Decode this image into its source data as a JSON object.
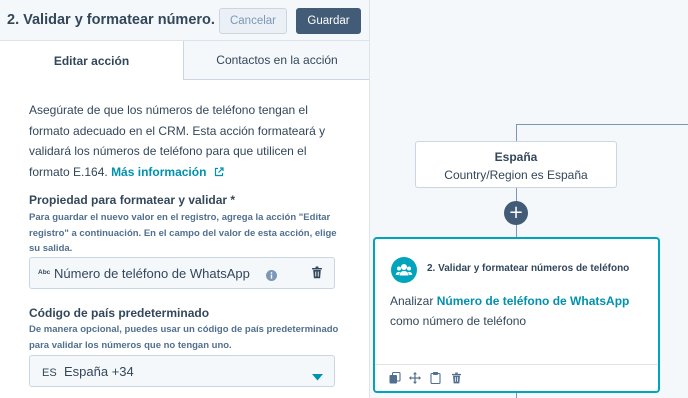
{
  "panel": {
    "title": "2. Validar y formatear número...",
    "cancel_label": "Cancelar",
    "save_label": "Guardar",
    "tabs": [
      {
        "label": "Editar acción",
        "active": true
      },
      {
        "label": "Contactos en la acción",
        "active": false
      }
    ],
    "description": "Asegúrate de que los números de teléfono tengan el formato adecuado en el CRM. Esta acción formateará y validará los números de teléfono para que utilicen el formato E.164.",
    "more_info_link": "Más información",
    "property": {
      "label": "Propiedad para formatear y validar *",
      "help": "Para guardar el nuevo valor en el registro, agrega la acción \"Editar registro\" a continuación. En el campo del valor de esta acción, elige su salida.",
      "type_badge": "Abc",
      "value": "Número de teléfono de WhatsApp"
    },
    "country": {
      "label": "Código de país predeterminado",
      "help": "De manera opcional, puedes usar un código de país predeterminado para validar los números que no tengan uno.",
      "code": "ES",
      "value": "España +34"
    }
  },
  "canvas": {
    "branch": {
      "title": "España",
      "description": "Country/Region es España"
    },
    "add_label": "+",
    "action_card": {
      "title": "2. Validar y formatear números de teléfono",
      "body_prefix": "Analizar",
      "body_highlight": "Número de teléfono de WhatsApp",
      "body_suffix": "como número de teléfono"
    }
  },
  "colors": {
    "accent": "#00a4bd",
    "link": "#0091ae",
    "primary_button": "#425b76",
    "text": "#33475b"
  },
  "icons": [
    "external-link-icon",
    "info-icon",
    "trash-icon",
    "chevron-down-icon",
    "contacts-icon",
    "clone-icon",
    "move-icon",
    "copy-icon"
  ]
}
